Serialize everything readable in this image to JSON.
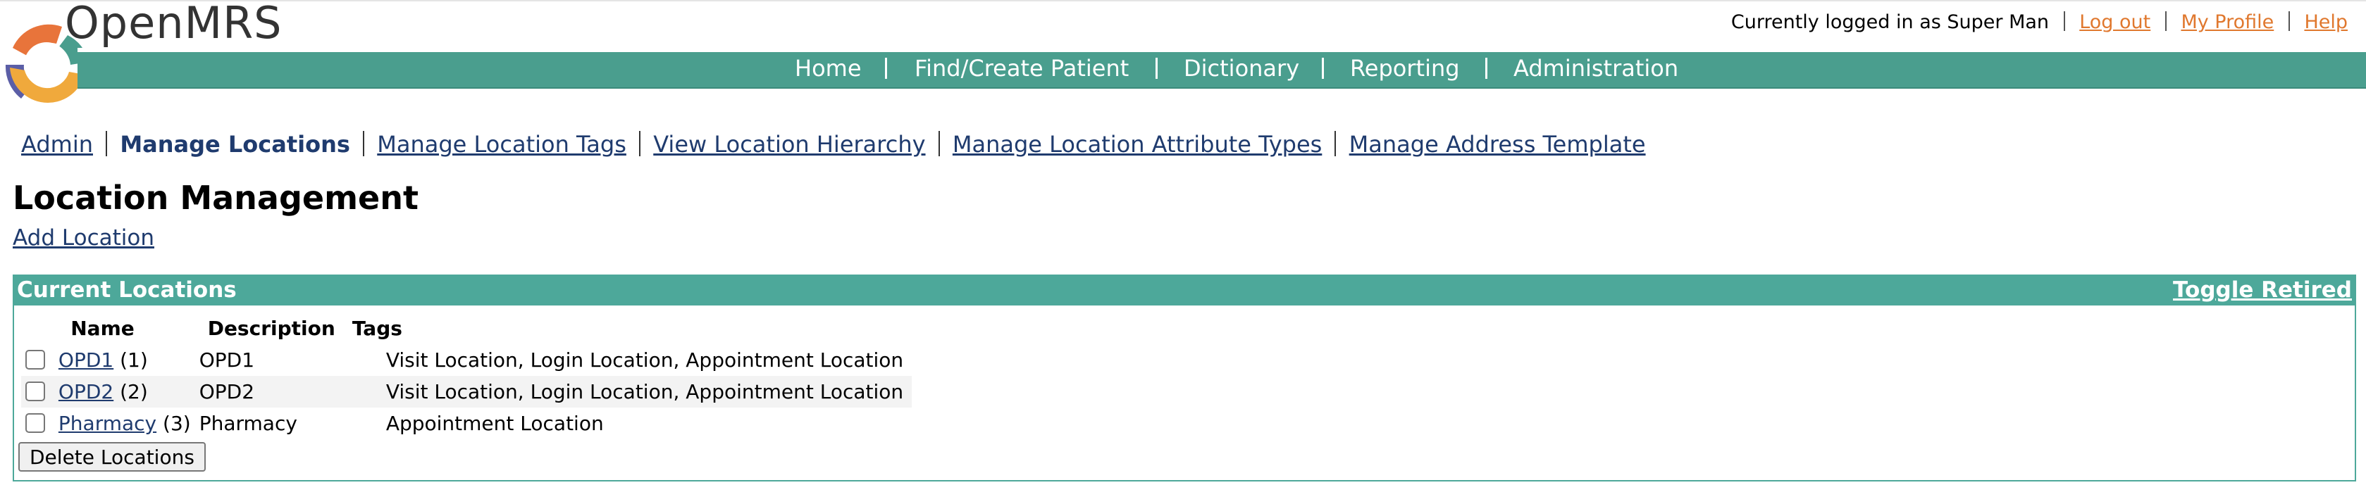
{
  "app": {
    "logo_text": "OpenMRS"
  },
  "nav": {
    "items": [
      "Home",
      "Find/Create Patient",
      "Dictionary",
      "Reporting",
      "Administration"
    ]
  },
  "user": {
    "logged_in_text": "Currently logged in as Super Man",
    "logout": "Log out",
    "profile": "My Profile",
    "help": "Help"
  },
  "subnav": {
    "admin": "Admin",
    "manage_locations": "Manage Locations",
    "manage_location_tags": "Manage Location Tags",
    "view_location_hierarchy": "View Location Hierarchy",
    "manage_location_attribute_types": "Manage Location Attribute Types",
    "manage_address_template": "Manage Address Template"
  },
  "page": {
    "title": "Location Management",
    "add_location": "Add Location"
  },
  "locations": {
    "box_title": "Current Locations",
    "toggle_retired": "Toggle Retired",
    "columns": [
      "Name",
      "Description",
      "Tags"
    ],
    "rows": [
      {
        "name": "OPD1",
        "id": "(1)",
        "description": "OPD1",
        "tags": "Visit Location, Login Location, Appointment Location"
      },
      {
        "name": "OPD2",
        "id": "(2)",
        "description": "OPD2",
        "tags": "Visit Location, Login Location, Appointment Location"
      },
      {
        "name": "Pharmacy",
        "id": "(3)",
        "description": "Pharmacy",
        "tags": "Appointment Location"
      }
    ],
    "delete_button": "Delete Locations"
  },
  "colors": {
    "header_teal": "#4a9e8e",
    "box_teal": "#4da89a",
    "link_blue": "#1f3b6e",
    "link_orange": "#e0782e",
    "logo_orange": "#e8743b",
    "logo_purple": "#5b5ea6",
    "logo_yellow": "#f0a93c"
  }
}
